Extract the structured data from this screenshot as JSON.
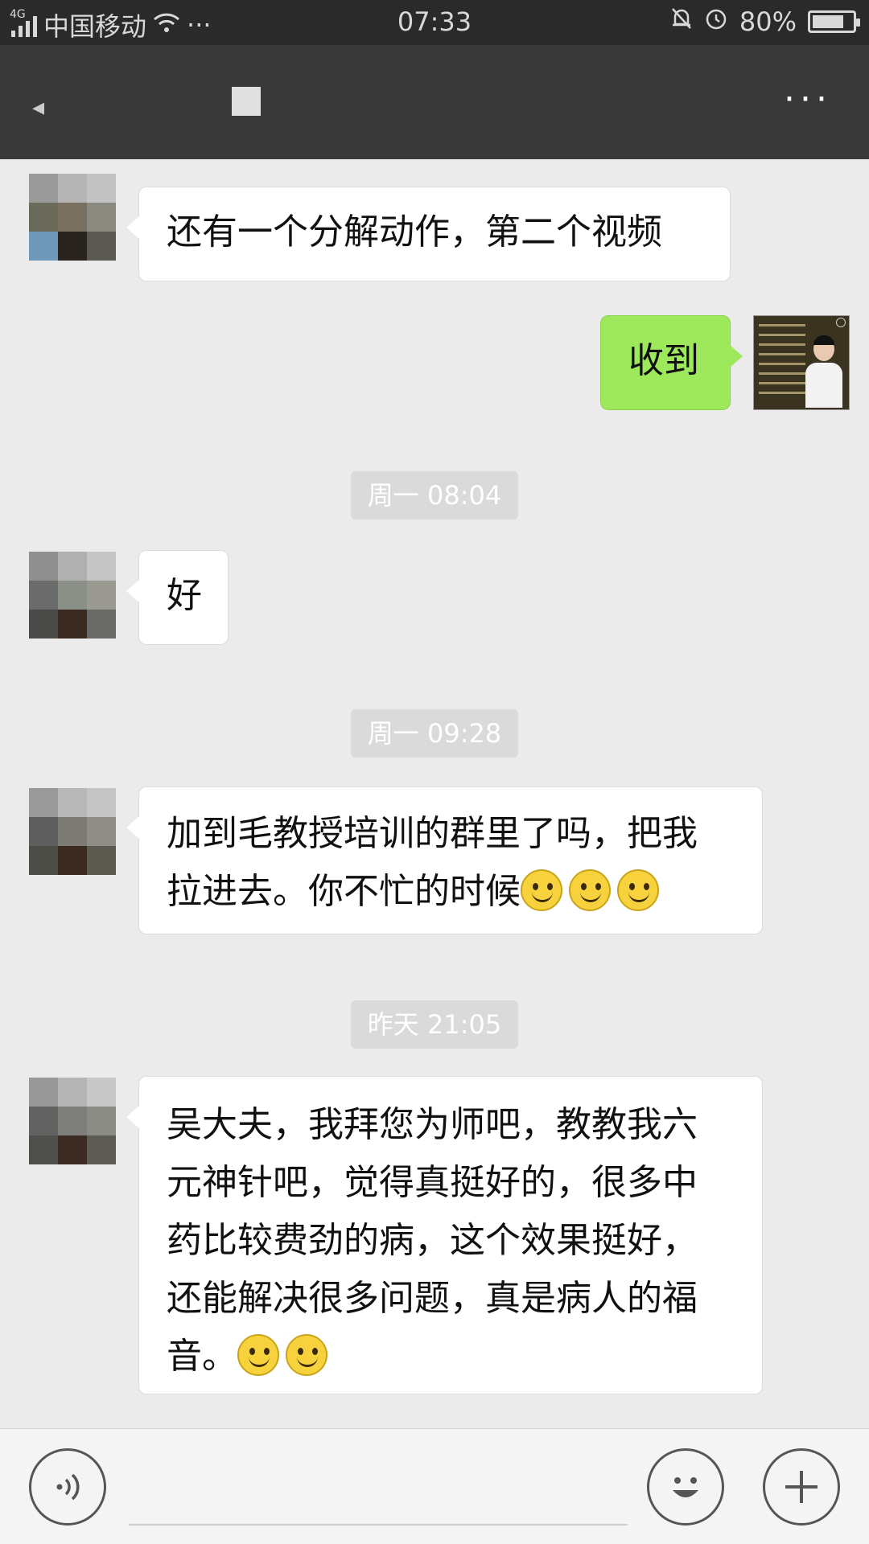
{
  "status_bar": {
    "network_type": "4G",
    "carrier": "中国移动",
    "extra": "···",
    "time": "07:33",
    "battery_percent_label": "80%",
    "battery_level": 0.8
  },
  "nav": {
    "back_icon": "back-chevron-icon",
    "more_label": "···"
  },
  "messages": [
    {
      "side": "left",
      "text": "还有一个分解动作，第二个视频"
    },
    {
      "side": "right",
      "text": "收到"
    },
    {
      "type": "time",
      "text": "周一 08:04"
    },
    {
      "side": "left",
      "text": "好"
    },
    {
      "type": "time",
      "text": "周一 09:28"
    },
    {
      "side": "left",
      "lines": [
        "加到毛教授培训的群里了吗，把我",
        "拉进去。你不忙的时候"
      ],
      "emoji_count": 3
    },
    {
      "type": "time",
      "text": "昨天 21:05"
    },
    {
      "side": "left",
      "lines": [
        "吴大夫，我拜您为师吧，教教我六",
        "元神针吧，觉得真挺好的，很多中",
        "药比较费劲的病，这个效果挺好，",
        "还能解决很多问题，真是病人的福",
        "音。"
      ],
      "emoji_count": 2
    }
  ],
  "bottom_bar": {
    "voice_icon": "voice-icon",
    "emoji_icon": "emoji-icon",
    "plus_icon": "plus-icon"
  },
  "colors": {
    "background": "#ebebeb",
    "header": "#393939",
    "status_bar": "#2a2a2a",
    "sent_bubble": "#9ee85b",
    "received_bubble": "#ffffff"
  }
}
